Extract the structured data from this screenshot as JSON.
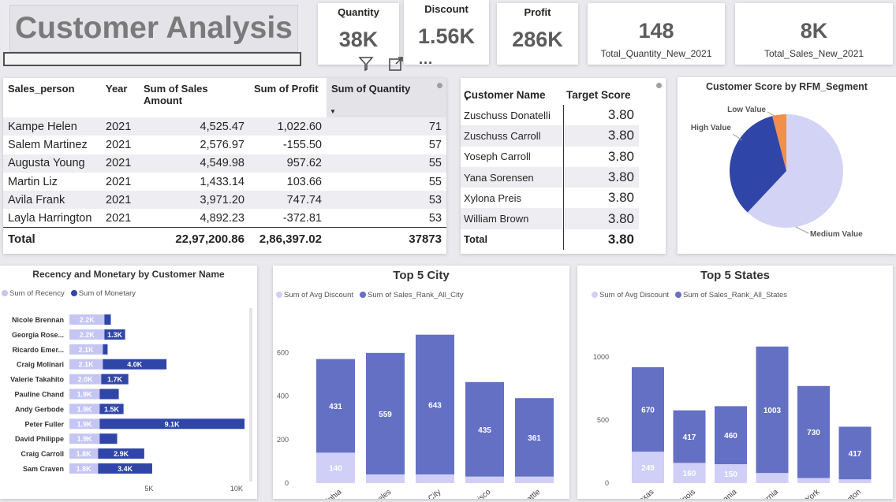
{
  "title": "Customer Analysis",
  "kpis": [
    {
      "label": "Quantity",
      "value": "38K"
    },
    {
      "label": "Discount",
      "value": "1.56K"
    },
    {
      "label": "Profit",
      "value": "286K"
    }
  ],
  "kpis2": [
    {
      "value": "148",
      "label": "Total_Quantity_New_2021"
    },
    {
      "value": "8K",
      "label": "Total_Sales_New_2021"
    }
  ],
  "visual_header": {
    "icons": [
      "filter-icon",
      "focus-mode-icon",
      "more-options-icon"
    ],
    "more": "···"
  },
  "sales_table": {
    "headers": [
      "Sales_person",
      "Year",
      "Sum of Sales Amount",
      "Sum of Profit",
      "Sum of Quantity"
    ],
    "rows": [
      [
        "Kampe Helen",
        "2021",
        "4,525.47",
        "1,022.60",
        "71"
      ],
      [
        "Salem Martinez",
        "2021",
        "2,576.97",
        "-155.50",
        "57"
      ],
      [
        "Augusta Young",
        "2021",
        "4,549.98",
        "957.62",
        "55"
      ],
      [
        "Martin Liz",
        "2021",
        "1,433.14",
        "103.66",
        "55"
      ],
      [
        "Avila Frank",
        "2021",
        "3,971.20",
        "747.74",
        "53"
      ],
      [
        "Layla Harrington",
        "2021",
        "4,892.23",
        "-372.81",
        "53"
      ]
    ],
    "total": [
      "Total",
      "",
      "22,97,200.86",
      "2,86,397.02",
      "37873"
    ],
    "sort_indicator": "▼"
  },
  "score_table": {
    "headers": [
      "Customer Name",
      "Target Score"
    ],
    "rows": [
      [
        "Zuschuss Donatelli",
        "3.80"
      ],
      [
        "Zuschuss Carroll",
        "3.80"
      ],
      [
        "Yoseph Carroll",
        "3.80"
      ],
      [
        "Yana Sorensen",
        "3.80"
      ],
      [
        "Xylona Preis",
        "3.80"
      ],
      [
        "William Brown",
        "3.80"
      ]
    ],
    "total": [
      "Total",
      "3.80"
    ],
    "sort_indicator": "▼"
  },
  "chart_data": [
    {
      "type": "pie",
      "title": "Customer Score by RFM_Segment",
      "categories": [
        "Medium Value",
        "High Value",
        "Low Value"
      ],
      "values": [
        62,
        34,
        4
      ],
      "colors": [
        "#d3d3f5",
        "#2f45a8",
        "#f0904a"
      ]
    },
    {
      "type": "bar",
      "orientation": "horizontal",
      "title": "Recency and Monetary by Customer Name",
      "categories": [
        "Nicole Brennan",
        "Georgia Rose...",
        "Ricardo Emer...",
        "Craig Molinari",
        "Valerie Takahito",
        "Pauline Chand",
        "Andy Gerbode",
        "Peter Fuller",
        "David Philippe",
        "Craig Carroll",
        "Sam Craven"
      ],
      "series": [
        {
          "name": "Sum of Recency",
          "values": [
            2200,
            2200,
            2100,
            2100,
            2000,
            1900,
            1900,
            1900,
            1900,
            1800,
            1800
          ],
          "labels": [
            "2.2K",
            "2.2K",
            "2.1K",
            "2.1K",
            "2.0K",
            "1.9K",
            "1.9K",
            "1.9K",
            "1.9K",
            "1.8K",
            "1.8K"
          ],
          "color": "#c5c5f3"
        },
        {
          "name": "Sum of Monetary",
          "values": [
            400,
            1300,
            300,
            4000,
            1700,
            1200,
            1500,
            9100,
            1100,
            2900,
            3400
          ],
          "labels": [
            "",
            "1.3K",
            "",
            "4.0K",
            "1.7K",
            "",
            "1.5K",
            "9.1K",
            "",
            "2.9K",
            "3.4K"
          ],
          "color": "#2f45a8"
        }
      ],
      "x_ticks": [
        "5K",
        "10K"
      ],
      "xlim": [
        0,
        10800
      ]
    },
    {
      "type": "bar",
      "title": "Top 5 City",
      "categories": [
        "Philadelphia",
        "Los Angeles",
        "New York City",
        "San Francisco",
        "Seattle"
      ],
      "series": [
        {
          "name": "Sum of Avg Discount",
          "values": [
            140,
            40,
            40,
            30,
            30
          ],
          "labels": [
            "140",
            "",
            "",
            "",
            ""
          ],
          "color": "#cfcff7"
        },
        {
          "name": "Sum of Sales_Rank_All_City",
          "values": [
            431,
            559,
            643,
            435,
            361
          ],
          "labels": [
            "431",
            "559",
            "643",
            "435",
            "361"
          ],
          "color": "#6470c4"
        }
      ],
      "y_ticks": [
        "0",
        "200",
        "400",
        "600"
      ],
      "ylim": [
        0,
        700
      ]
    },
    {
      "type": "bar",
      "title": "Top 5 States",
      "categories": [
        "Texas",
        "Illinois",
        "Pennsylvania",
        "California",
        "New York",
        "Washington"
      ],
      "series": [
        {
          "name": "Sum of Avg Discount",
          "values": [
            249,
            160,
            150,
            80,
            40,
            30
          ],
          "labels": [
            "249",
            "160",
            "150",
            "",
            "",
            ""
          ],
          "color": "#cfcff7"
        },
        {
          "name": "Sum of Sales_Rank_All_States",
          "values": [
            670,
            417,
            460,
            1003,
            730,
            417
          ],
          "labels": [
            "670",
            "417",
            "460",
            "1003",
            "730",
            "417"
          ],
          "color": "#6470c4"
        }
      ],
      "y_ticks": [
        "0",
        "500",
        "1000"
      ],
      "ylim": [
        0,
        1100
      ]
    }
  ]
}
